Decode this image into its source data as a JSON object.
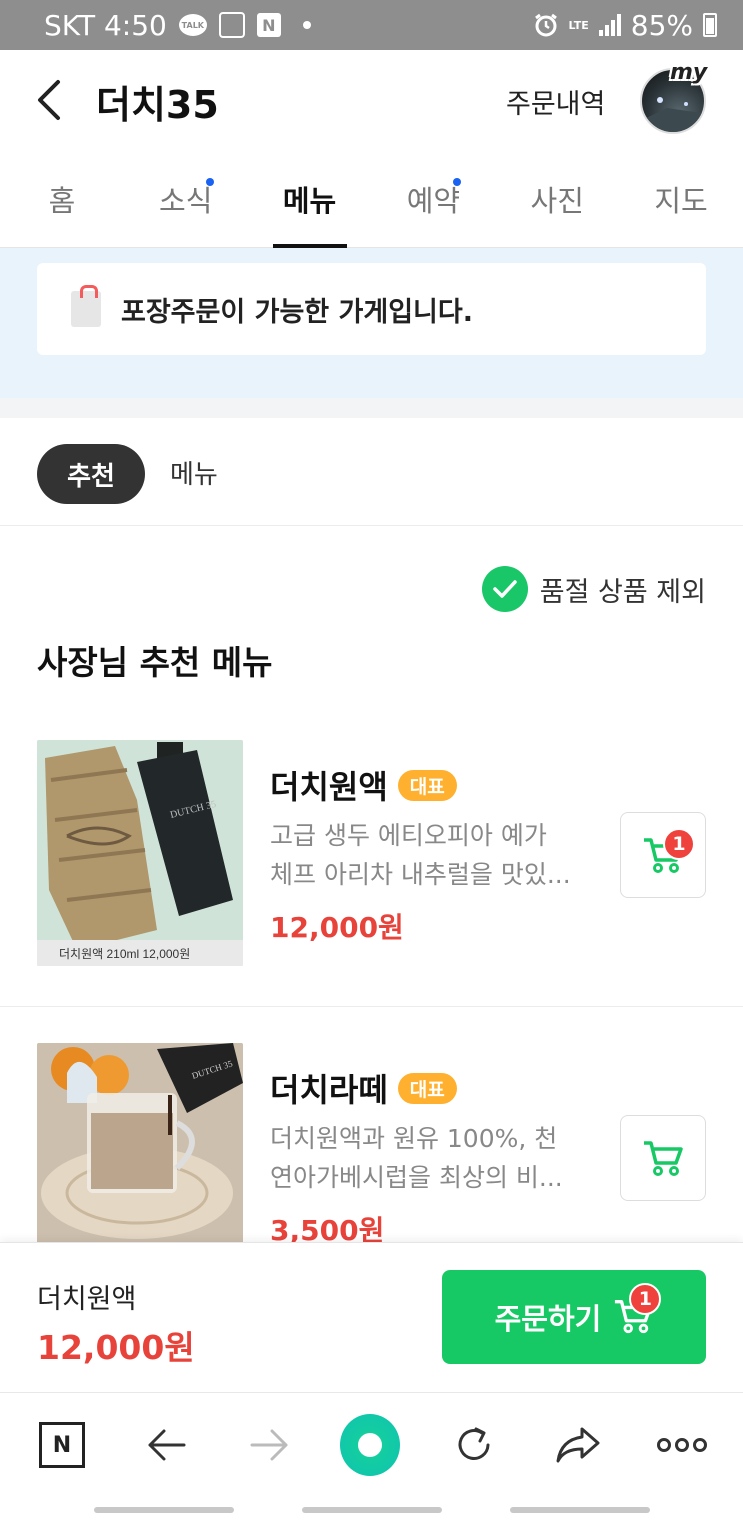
{
  "status_bar": {
    "carrier_time": "SKT 4:50",
    "talk_icon_label": "TALK",
    "n_icon_label": "N",
    "lte_label": "LTE",
    "battery": "85%"
  },
  "header": {
    "title": "더치35",
    "order_history": "주문내역",
    "avatar_label": "my"
  },
  "tabs": [
    {
      "label": "홈",
      "active": false,
      "new": false
    },
    {
      "label": "소식",
      "active": false,
      "new": true
    },
    {
      "label": "메뉴",
      "active": true,
      "new": false
    },
    {
      "label": "예약",
      "active": false,
      "new": true
    },
    {
      "label": "사진",
      "active": false,
      "new": false
    },
    {
      "label": "지도",
      "active": false,
      "new": false
    }
  ],
  "banner": {
    "text": "포장주문이 가능한 가게입니다."
  },
  "subtabs": {
    "active": "추천",
    "other": "메뉴"
  },
  "filter": {
    "label": "품절 상품 제외",
    "checked": true
  },
  "section_title": "사장님 추천 메뉴",
  "menu_items": [
    {
      "name": "더치원액",
      "badge": "대표",
      "desc_line1": "고급 생두 에티오피아 예가",
      "desc_line2": "체프 아리차 내추럴을 맛있...",
      "price": "12,000원",
      "cart_count": "1",
      "photo_caption": "더치원액 210ml   12,000원",
      "bottle_label": "DUTCH 35"
    },
    {
      "name": "더치라떼",
      "badge": "대표",
      "desc_line1": "더치원액과 원유 100%, 천",
      "desc_line2": "연아가베시럽을 최상의 비...",
      "price": "3,500원",
      "cart_count": "",
      "bottle_label": "DUTCH 35"
    }
  ],
  "order_bar": {
    "selected_name": "더치원액",
    "selected_price": "12,000원",
    "button_label": "주문하기",
    "cart_count": "1"
  },
  "browser": {
    "logo": "N"
  },
  "colors": {
    "accent_green": "#17c964",
    "price_red": "#e8433b",
    "badge_orange": "#ffb02e",
    "new_dot_blue": "#1a62f2",
    "banner_bg": "#e8f3fb"
  }
}
